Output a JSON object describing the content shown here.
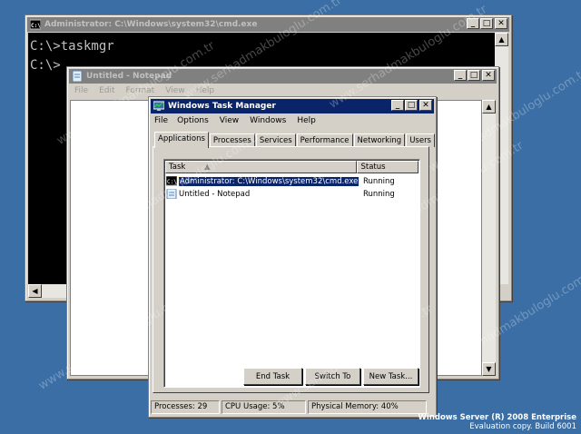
{
  "cmd": {
    "title": "Administrator: C:\\Windows\\system32\\cmd.exe",
    "lines": [
      "C:\\>taskmgr",
      "C:\\>"
    ]
  },
  "notepad": {
    "title": "Untitled - Notepad",
    "menu": [
      "File",
      "Edit",
      "Format",
      "View",
      "Help"
    ]
  },
  "taskmanager": {
    "title": "Windows Task Manager",
    "menu": [
      "File",
      "Options",
      "View",
      "Windows",
      "Help"
    ],
    "tabs": [
      "Applications",
      "Processes",
      "Services",
      "Performance",
      "Networking",
      "Users"
    ],
    "columns": [
      "Task",
      "Status"
    ],
    "rows": [
      {
        "task": "Administrator: C:\\Windows\\system32\\cmd.exe",
        "status": "Running"
      },
      {
        "task": "Untitled - Notepad",
        "status": "Running"
      }
    ],
    "buttons": {
      "end_task": "End Task",
      "switch_to": "Switch To",
      "new_task": "New Task..."
    },
    "statusbar": {
      "processes": "Processes: 29",
      "cpu": "CPU Usage: 5%",
      "memory": "Physical Memory: 40%"
    }
  },
  "branding": {
    "line1": "Windows Server (R) 2008 Enterprise",
    "line2": "Evaluation copy. Build 6001"
  },
  "watermark": "www.serhadmakbuloglu.com.tr",
  "colors": {
    "desktop": "#3a6ea5",
    "active_title": "#0a246a",
    "inactive_title": "#808080",
    "face": "#d4d0c8"
  }
}
